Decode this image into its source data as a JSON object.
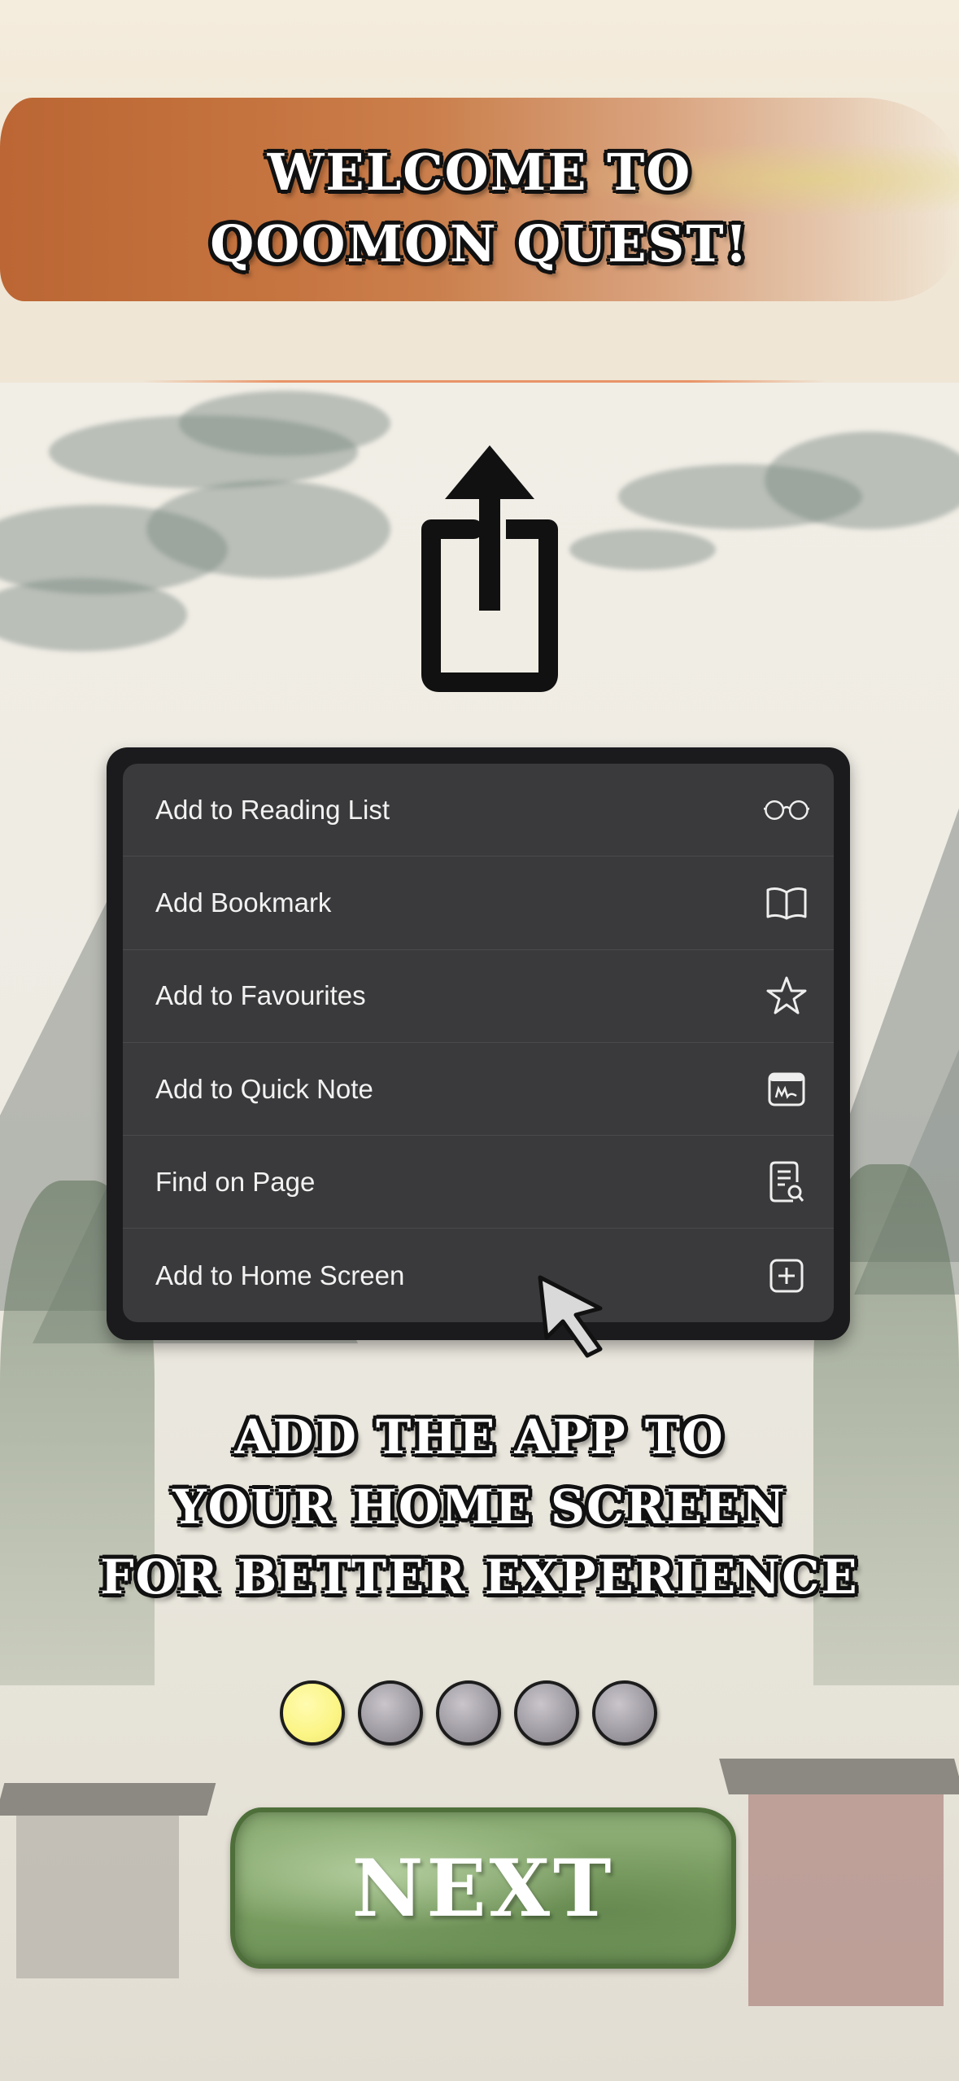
{
  "header": {
    "title_line1": "WELCOME TO",
    "title_line2": "QOOMON QUEST!"
  },
  "share_icon": "share-icon",
  "menu": {
    "items": [
      {
        "label": "Add to Reading List",
        "icon": "glasses-icon"
      },
      {
        "label": "Add Bookmark",
        "icon": "book-icon"
      },
      {
        "label": "Add to Favourites",
        "icon": "star-icon"
      },
      {
        "label": "Add to Quick Note",
        "icon": "quick-note-icon"
      },
      {
        "label": "Find on Page",
        "icon": "find-page-icon"
      },
      {
        "label": "Add to Home Screen",
        "icon": "add-square-icon"
      }
    ]
  },
  "instruction": {
    "line1": "ADD THE APP TO",
    "line2": "YOUR HOME SCREEN",
    "line3": "FOR BETTER EXPERIENCE"
  },
  "pagination": {
    "total": 5,
    "current": 1
  },
  "next_button": {
    "label": "NEXT"
  },
  "colors": {
    "menu_bg": "#3a3a3c",
    "active_dot": "#fbf585",
    "inactive_dot": "#a19da4",
    "button_green": "#7fa266",
    "banner_orange": "#c26c36"
  }
}
